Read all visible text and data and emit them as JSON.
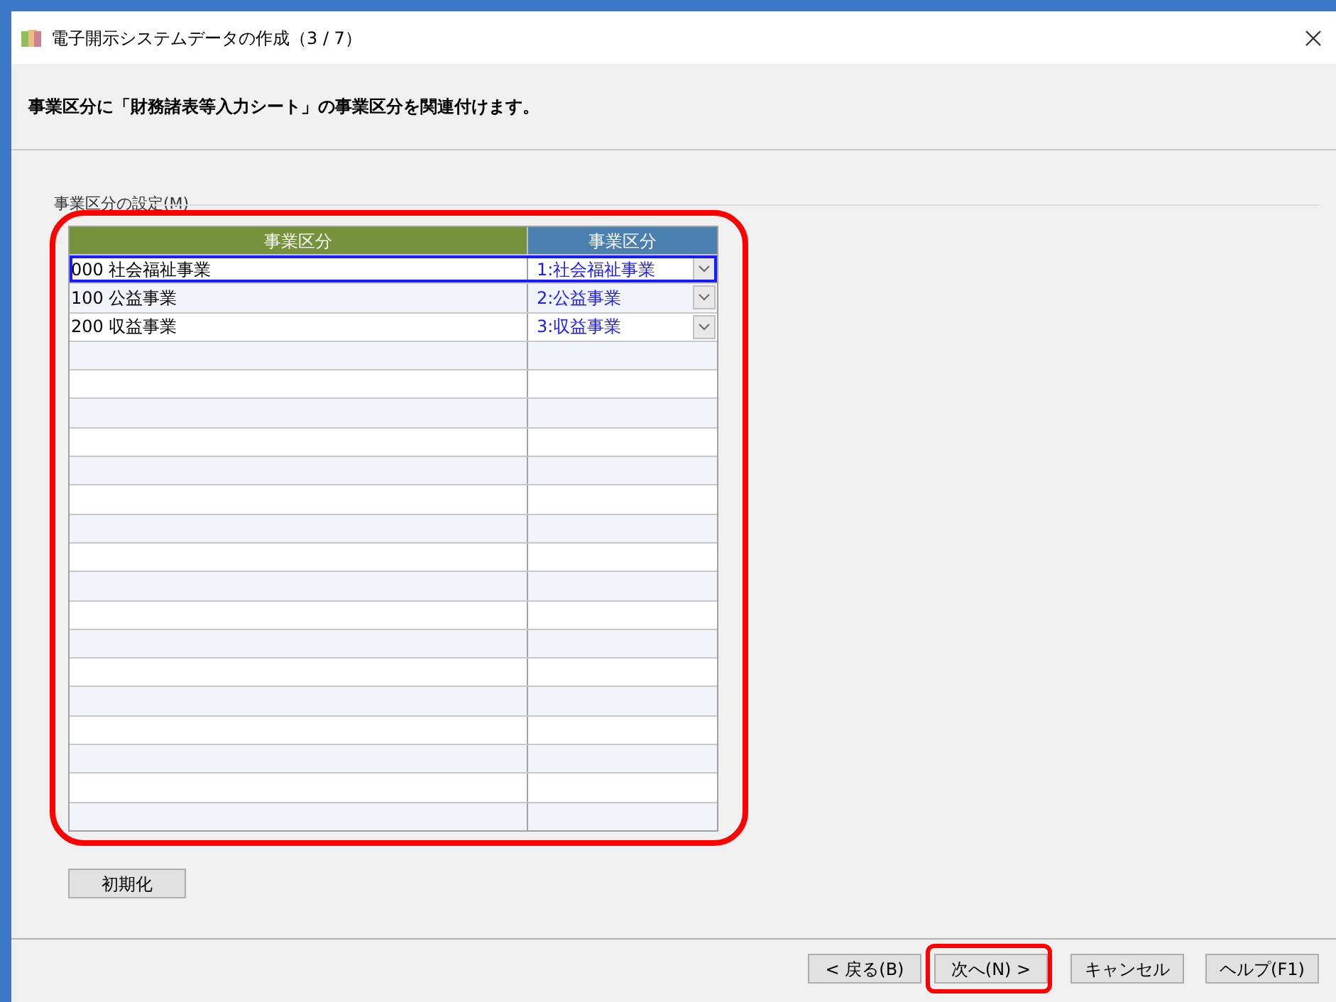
{
  "window": {
    "title": "電子開示システムデータの作成（3 / 7）"
  },
  "instruction": "事業区分に「財務諸表等入力シート」の事業区分を関連付けます。",
  "group": {
    "label": "事業区分の設定(M)",
    "highlighted": true
  },
  "table": {
    "columns": [
      "事業区分",
      "事業区分"
    ],
    "rows": [
      {
        "division": "000 社会福祉事業",
        "mapped": "1:社会福祉事業",
        "selected": true
      },
      {
        "division": "100 公益事業",
        "mapped": "2:公益事業",
        "selected": false
      },
      {
        "division": "200 収益事業",
        "mapped": "3:収益事業",
        "selected": false
      }
    ]
  },
  "reset_button": "初期化",
  "buttons": [
    {
      "label": "< 戻る(B)",
      "highlighted": false
    },
    {
      "label": "次へ(N) >",
      "highlighted": true
    },
    {
      "label": "キャンセル",
      "highlighted": false
    },
    {
      "label": "ヘルプ(F1)",
      "highlighted": false
    }
  ]
}
